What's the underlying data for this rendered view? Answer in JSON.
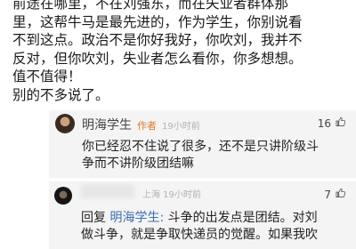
{
  "main_comment": {
    "lines": [
      "前途在哪里，不在刘强东，而在失业者群体那",
      "里，这帮牛马是最先进的，作为学生，你别说看",
      "不到这点。政治不是你好我好，你吹刘，我并不",
      "反对，但你吹刘，失业者怎么看你，你多想想。",
      "值不值得！",
      "别的不多说了。"
    ]
  },
  "replies": [
    {
      "author": "明海学生",
      "badge": "作者",
      "time": "19小时前",
      "likes": "16",
      "text_lines": [
        "你已经忍不住说了很多，还不是只讲阶级斗",
        "争而不讲阶级团结嘛"
      ]
    },
    {
      "author": "",
      "location_time": "上海  19小时前",
      "likes": "7",
      "reply_prefix": "回复 ",
      "mention": "明海学生:",
      "text_lines": [
        " 斗争的出发点是团结。对刘",
        "做斗争，就是争取快递员的觉醒。如果我吹"
      ]
    }
  ],
  "colors": {
    "reply_background": "#f4f4f4",
    "author_badge": "#e07a2a",
    "mention": "#3a6fb3",
    "meta": "#b0b0b0"
  },
  "icons": [
    "avatar",
    "like-icon"
  ]
}
